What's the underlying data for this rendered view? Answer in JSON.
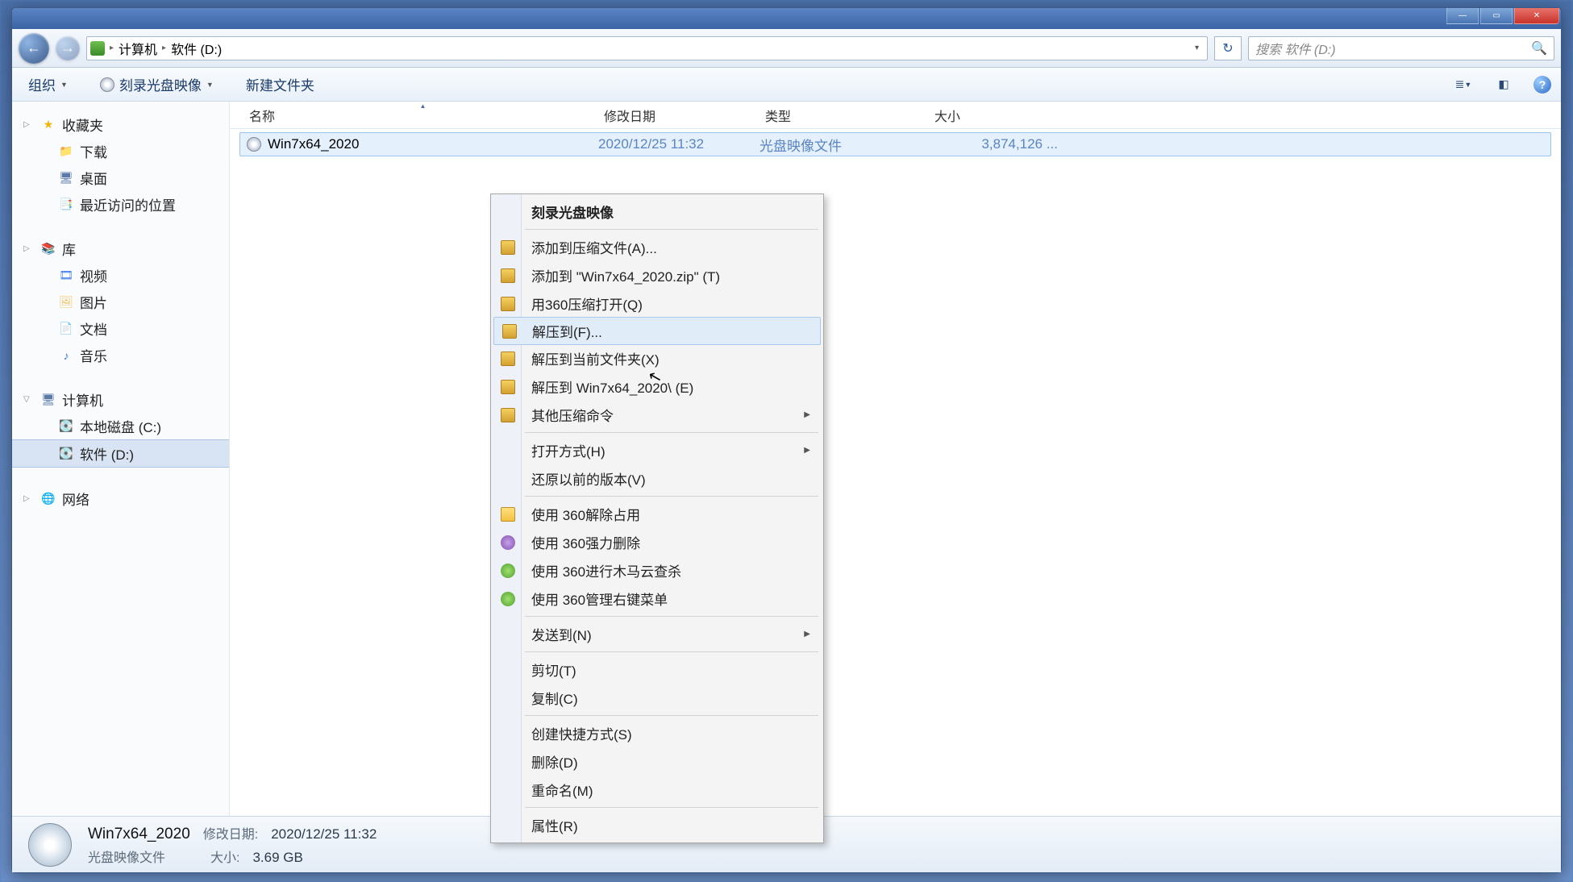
{
  "window_controls": {
    "min": "—",
    "max": "▭",
    "close": "✕"
  },
  "breadcrumb": {
    "parts": [
      "计算机",
      "软件 (D:)"
    ],
    "chevron": "▸"
  },
  "search": {
    "placeholder": "搜索 软件 (D:)"
  },
  "toolbar": {
    "organize": "组织",
    "burn": "刻录光盘映像",
    "newfolder": "新建文件夹"
  },
  "sidebar": {
    "favorites": {
      "label": "收藏夹",
      "items": [
        "下载",
        "桌面",
        "最近访问的位置"
      ]
    },
    "libraries": {
      "label": "库",
      "items": [
        "视频",
        "图片",
        "文档",
        "音乐"
      ]
    },
    "computer": {
      "label": "计算机",
      "items": [
        "本地磁盘 (C:)",
        "软件 (D:)"
      ],
      "selected": 1
    },
    "network": {
      "label": "网络"
    }
  },
  "columns": {
    "name": "名称",
    "date": "修改日期",
    "type": "类型",
    "size": "大小"
  },
  "files": [
    {
      "name": "Win7x64_2020",
      "date": "2020/12/25 11:32",
      "type": "光盘映像文件",
      "size": "3,874,126 ..."
    }
  ],
  "context_menu": [
    {
      "label": "刻录光盘映像",
      "bold": true
    },
    {
      "sep": true
    },
    {
      "label": "添加到压缩文件(A)...",
      "icon": "arch"
    },
    {
      "label": "添加到 \"Win7x64_2020.zip\" (T)",
      "icon": "arch"
    },
    {
      "label": "用360压缩打开(Q)",
      "icon": "arch"
    },
    {
      "label": "解压到(F)...",
      "icon": "arch",
      "hover": true
    },
    {
      "label": "解压到当前文件夹(X)",
      "icon": "arch"
    },
    {
      "label": "解压到 Win7x64_2020\\ (E)",
      "icon": "arch"
    },
    {
      "label": "其他压缩命令",
      "icon": "arch",
      "sub": true
    },
    {
      "sep": true
    },
    {
      "label": "打开方式(H)",
      "sub": true
    },
    {
      "label": "还原以前的版本(V)"
    },
    {
      "sep": true
    },
    {
      "label": "使用 360解除占用",
      "icon": "yel"
    },
    {
      "label": "使用 360强力删除",
      "icon": "purp"
    },
    {
      "label": "使用 360进行木马云查杀",
      "icon": "grn"
    },
    {
      "label": "使用 360管理右键菜单",
      "icon": "grn"
    },
    {
      "sep": true
    },
    {
      "label": "发送到(N)",
      "sub": true
    },
    {
      "sep": true
    },
    {
      "label": "剪切(T)"
    },
    {
      "label": "复制(C)"
    },
    {
      "sep": true
    },
    {
      "label": "创建快捷方式(S)"
    },
    {
      "label": "删除(D)"
    },
    {
      "label": "重命名(M)"
    },
    {
      "sep": true
    },
    {
      "label": "属性(R)"
    }
  ],
  "status": {
    "filename": "Win7x64_2020",
    "filetype": "光盘映像文件",
    "date_label": "修改日期:",
    "date_value": "2020/12/25 11:32",
    "size_label": "大小:",
    "size_value": "3.69 GB"
  }
}
